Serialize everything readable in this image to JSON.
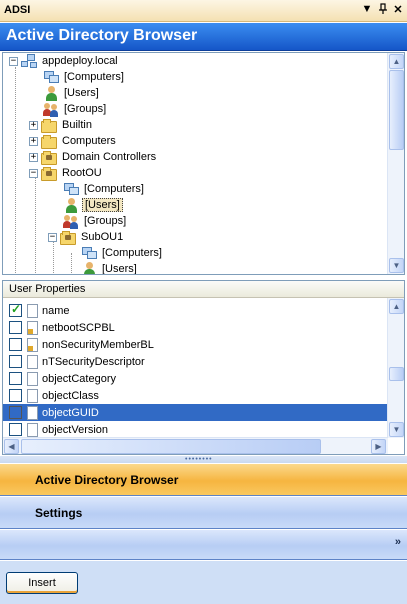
{
  "window": {
    "title": "ADSI",
    "controls": {
      "dropdown": "▼",
      "pin": "ᵖ",
      "close": "✕"
    }
  },
  "header": {
    "title": "Active Directory Browser"
  },
  "tree": {
    "nodes": [
      {
        "label": "appdeploy.local",
        "icon": "domain-icon",
        "expander": "−"
      },
      {
        "label": "[Computers]",
        "icon": "computers-icon"
      },
      {
        "label": "[Users]",
        "icon": "user-icon"
      },
      {
        "label": "[Groups]",
        "icon": "group-icon"
      },
      {
        "label": "Builtin",
        "icon": "folder-icon",
        "expander": "+"
      },
      {
        "label": "Computers",
        "icon": "folder-icon",
        "expander": "+"
      },
      {
        "label": "Domain Controllers",
        "icon": "ou-folder-icon",
        "expander": "+"
      },
      {
        "label": "RootOU",
        "icon": "ou-folder-icon",
        "expander": "−"
      },
      {
        "label": "[Computers]",
        "icon": "computers-icon"
      },
      {
        "label": "[Users]",
        "icon": "user-icon",
        "selected": true
      },
      {
        "label": "[Groups]",
        "icon": "group-icon"
      },
      {
        "label": "SubOU1",
        "icon": "ou-folder-icon",
        "expander": "−"
      },
      {
        "label": "[Computers]",
        "icon": "computers-icon"
      },
      {
        "label": "[Users]",
        "icon": "user-icon"
      }
    ]
  },
  "properties": {
    "header": "User Properties",
    "items": [
      {
        "label": "name",
        "checked": true,
        "locked": false
      },
      {
        "label": "netbootSCPBL",
        "checked": false,
        "locked": true
      },
      {
        "label": "nonSecurityMemberBL",
        "checked": false,
        "locked": true
      },
      {
        "label": "nTSecurityDescriptor",
        "checked": false,
        "locked": false
      },
      {
        "label": "objectCategory",
        "checked": false,
        "locked": false
      },
      {
        "label": "objectClass",
        "checked": false,
        "locked": false
      },
      {
        "label": "objectGUID",
        "checked": false,
        "locked": false,
        "selected": true
      },
      {
        "label": "objectVersion",
        "checked": false,
        "locked": false
      }
    ]
  },
  "nav": {
    "active_browser": "Active Directory Browser",
    "settings": "Settings",
    "more": "»"
  },
  "bottom": {
    "insert_label": "Insert"
  },
  "colors": {
    "header_blue": "#1556c8",
    "nav_active": "#f6b540",
    "selection": "#316ac5"
  }
}
